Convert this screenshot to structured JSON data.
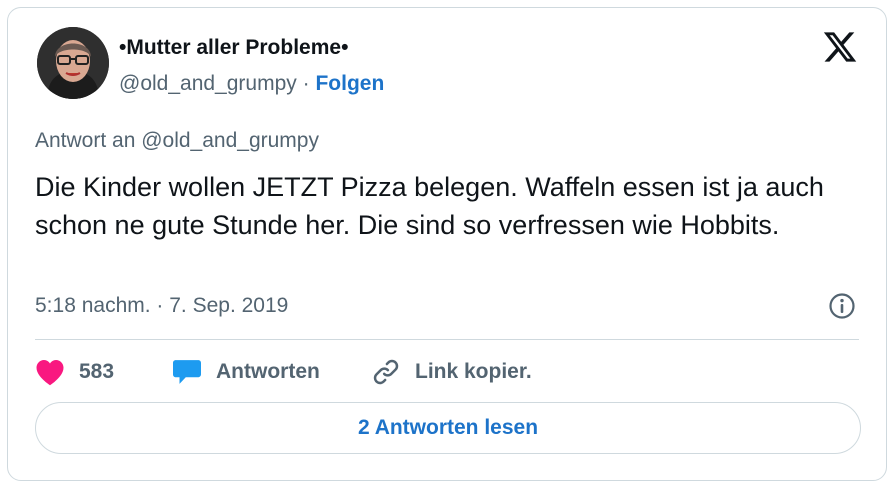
{
  "author": {
    "display_name": "•Mutter aller Probleme•",
    "handle": "@old_and_grumpy",
    "separator": "·",
    "follow_label": "Folgen"
  },
  "tweet": {
    "reply_to": "Antwort an @old_and_grumpy",
    "text": "Die Kinder wollen JETZT Pizza belegen. Waffeln essen ist ja auch schon ne gute Stunde her. Die sind so verfressen wie Hobbits.",
    "timestamp": "5:18 nachm. · 7. Sep. 2019"
  },
  "actions": {
    "like_count": "583",
    "reply_label": "Antworten",
    "copy_link_label": "Link kopier."
  },
  "read_replies_label": "2 Antworten lesen",
  "colors": {
    "like": "#f91880",
    "reply": "#1d9bf0",
    "link": "#1d73c9",
    "muted": "#536471",
    "border": "#cfd9de"
  },
  "icons": [
    "x-logo-icon",
    "info-icon",
    "heart-icon",
    "speech-bubble-icon",
    "link-icon"
  ]
}
